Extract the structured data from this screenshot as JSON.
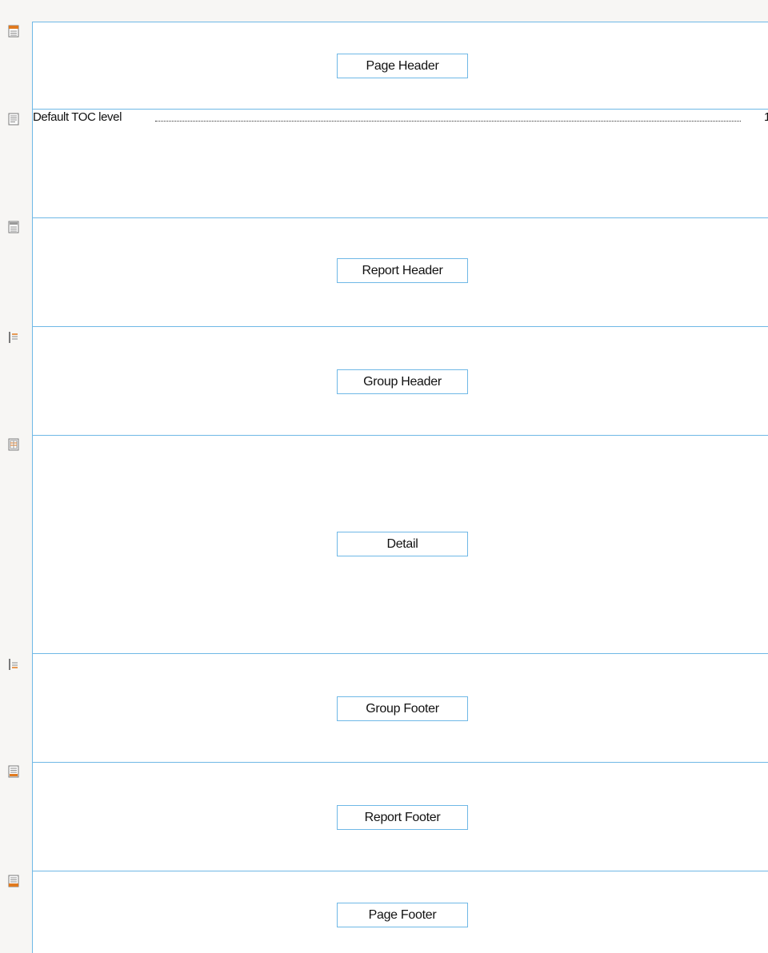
{
  "bands": [
    {
      "id": "page-header",
      "label": "Page Header",
      "icon": "page-header-icon"
    },
    {
      "id": "toc",
      "label": "",
      "icon": "toc-icon"
    },
    {
      "id": "report-header",
      "label": "Report Header",
      "icon": "report-header-icon"
    },
    {
      "id": "group-header",
      "label": "Group Header",
      "icon": "group-header-icon"
    },
    {
      "id": "detail",
      "label": "Detail",
      "icon": "detail-icon"
    },
    {
      "id": "group-footer",
      "label": "Group Footer",
      "icon": "group-footer-icon"
    },
    {
      "id": "report-footer",
      "label": "Report Footer",
      "icon": "report-footer-icon"
    },
    {
      "id": "page-footer",
      "label": "Page Footer",
      "icon": "page-footer-icon"
    }
  ],
  "toc": {
    "entry_text": "Default TOC level",
    "page_number": "1"
  },
  "colors": {
    "band_border": "#6fb8e6",
    "gutter": "#f7f6f4",
    "icon_accent": "#e07a1f"
  }
}
